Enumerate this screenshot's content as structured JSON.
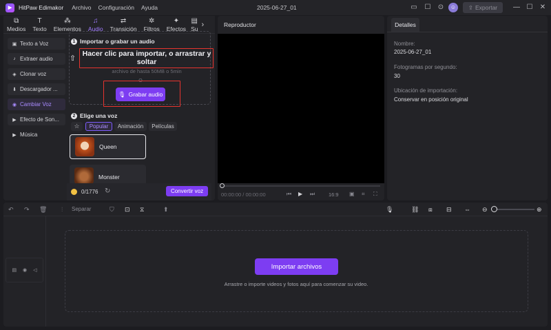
{
  "titlebar": {
    "app_name": "HitPaw Edimakor",
    "menu": [
      "Archivo",
      "Configuración",
      "Ayuda"
    ],
    "project_title": "2025-06-27_01",
    "export_label": "Exportar"
  },
  "tabs": [
    {
      "label": "Medios",
      "icon": "media-icon"
    },
    {
      "label": "Texto",
      "icon": "text-icon"
    },
    {
      "label": "Elementos",
      "icon": "elements-icon"
    },
    {
      "label": "Audio",
      "icon": "audio-icon"
    },
    {
      "label": "Transición",
      "icon": "transition-icon"
    },
    {
      "label": "Filtros",
      "icon": "filter-icon"
    },
    {
      "label": "Efectos",
      "icon": "effects-icon"
    },
    {
      "label": "Su",
      "icon": "subtitle-icon"
    }
  ],
  "sidebar": [
    {
      "label": "Texto a Voz"
    },
    {
      "label": "Extraer audio"
    },
    {
      "label": "Clonar voz"
    },
    {
      "label": "Descargador ..."
    },
    {
      "label": "Cambiar Voz"
    },
    {
      "label": "Efecto de Son..."
    },
    {
      "label": "Música"
    }
  ],
  "import_section": {
    "step": "1",
    "title": "Importar o grabar un audio",
    "drop_text": "Hacer clic para importar, o arrastrar y soltar",
    "size_hint": "archivo de hasta 50MB o 5min",
    "or_text": "O",
    "record_label": "Grabar audio"
  },
  "voice_section": {
    "step": "2",
    "title": "Elige una voz",
    "filters": [
      "Popular",
      "Animación",
      "Películas"
    ],
    "voices": [
      {
        "name": "Queen"
      },
      {
        "name": "Monster"
      }
    ]
  },
  "credits": {
    "count": "0/1776",
    "convert_label": "Convertir voz"
  },
  "player": {
    "title": "Reproductor",
    "time": "00:00:00 / 00:00:00",
    "aspect": "16:9"
  },
  "details": {
    "tab": "Detalles",
    "name_label": "Nombre:",
    "name_value": "2025-06-27_01",
    "fps_label": "Fotogramas por segundo:",
    "fps_value": "30",
    "location_label": "Ubicación de importación:",
    "location_value": "Conservar en posición original"
  },
  "timeline": {
    "split_label": "Separar",
    "import_label": "Importar archivos",
    "hint": "Arrastre o importe videos y fotos aquí para comenzar su video."
  },
  "colors": {
    "accent": "#7d3df2",
    "highlight": "#e8342f",
    "active_text": "#a07bff"
  }
}
